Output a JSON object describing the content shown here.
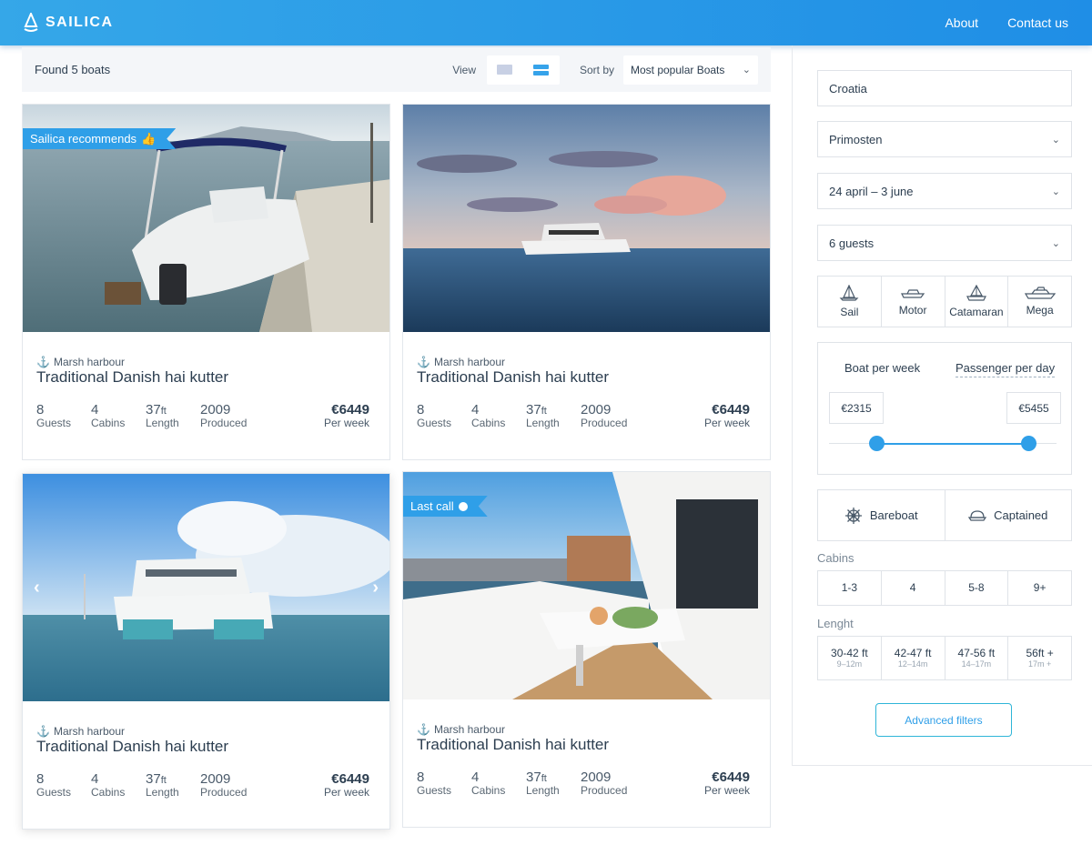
{
  "header": {
    "logo": "SAILICA",
    "nav": [
      "About",
      "Contact us"
    ]
  },
  "toolbar": {
    "found": "Found 5 boats",
    "view_label": "View",
    "sort_label": "Sort by",
    "sort_value": "Most popular Boats"
  },
  "cards": [
    {
      "badge": "Sailica recommends",
      "location": "Marsh harbour",
      "title": "Traditional Danish hai kutter",
      "guests": "8",
      "guests_label": "Guests",
      "cabins": "4",
      "cabins_label": "Cabins",
      "length": "37",
      "length_unit": "ft",
      "length_label": "Length",
      "year": "2009",
      "year_label": "Produced",
      "price": "€6449",
      "price_label": "Per week"
    },
    {
      "badge": "",
      "location": "Marsh harbour",
      "title": "Traditional Danish hai kutter",
      "guests": "8",
      "guests_label": "Guests",
      "cabins": "4",
      "cabins_label": "Cabins",
      "length": "37",
      "length_unit": "ft",
      "length_label": "Length",
      "year": "2009",
      "year_label": "Produced",
      "price": "€6449",
      "price_label": "Per week"
    },
    {
      "badge": "",
      "location": "Marsh harbour",
      "title": "Traditional Danish hai kutter",
      "guests": "8",
      "guests_label": "Guests",
      "cabins": "4",
      "cabins_label": "Cabins",
      "length": "37",
      "length_unit": "ft",
      "length_label": "Length",
      "year": "2009",
      "year_label": "Produced",
      "price": "€6449",
      "price_label": "Per week"
    },
    {
      "badge": "Last call",
      "location": "Marsh harbour",
      "title": "Traditional Danish hai kutter",
      "guests": "8",
      "guests_label": "Guests",
      "cabins": "4",
      "cabins_label": "Cabins",
      "length": "37",
      "length_unit": "ft",
      "length_label": "Length",
      "year": "2009",
      "year_label": "Produced",
      "price": "€6449",
      "price_label": "Per week"
    }
  ],
  "filters": {
    "country": "Croatia",
    "city": "Primosten",
    "dates": "24 april – 3 june",
    "guests": "6 guests",
    "types": [
      "Sail",
      "Motor",
      "Catamaran",
      "Mega"
    ],
    "price_tabs": [
      "Boat per week",
      "Passenger per day"
    ],
    "price_min": "€2315",
    "price_max": "€5455",
    "captain": [
      "Bareboat",
      "Captained"
    ],
    "cabins_label": "Cabins",
    "cabins": [
      "1-3",
      "4",
      "5-8",
      "9+"
    ],
    "length_label": "Lenght",
    "lengths": [
      {
        "ft": "30-42 ft",
        "m": "9–12m"
      },
      {
        "ft": "42-47 ft",
        "m": "12–14m"
      },
      {
        "ft": "47-56 ft",
        "m": "14–17m"
      },
      {
        "ft": "56ft +",
        "m": "17m +"
      }
    ],
    "advanced": "Advanced filters"
  },
  "colors": {
    "accent": "#2f9fe8",
    "header_start": "#35a7e8",
    "header_end": "#1f8ee6"
  }
}
